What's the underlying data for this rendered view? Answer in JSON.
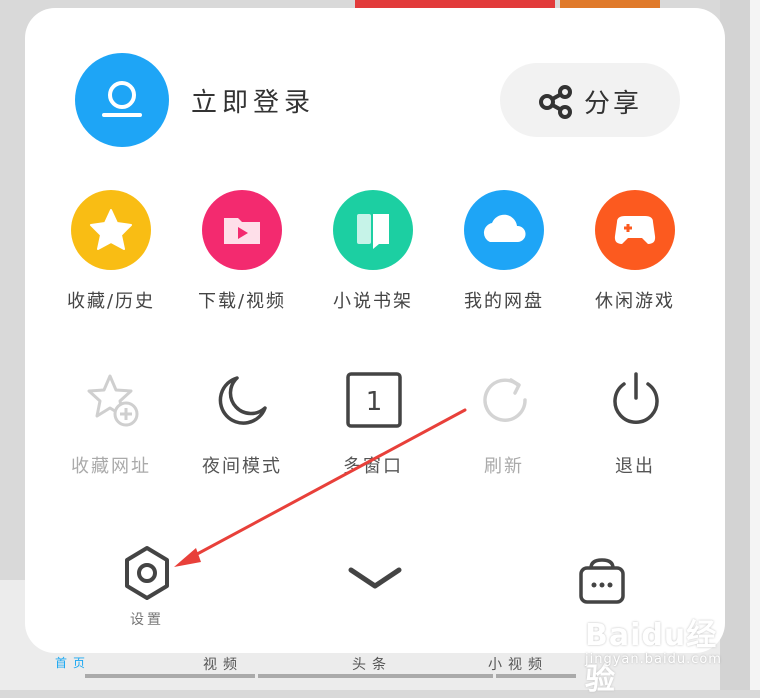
{
  "header": {
    "login_label": "立即登录",
    "share_label": "分享"
  },
  "apps": [
    {
      "label": "收藏/历史",
      "color": "#f9bd14",
      "icon": "star-icon"
    },
    {
      "label": "下载/视频",
      "color": "#f32a6f",
      "icon": "video-folder-icon"
    },
    {
      "label": "小说书架",
      "color": "#1ccfa2",
      "icon": "book-icon"
    },
    {
      "label": "我的网盘",
      "color": "#1ea5f6",
      "icon": "cloud-icon"
    },
    {
      "label": "休闲游戏",
      "color": "#fc5a1f",
      "icon": "gamepad-icon"
    }
  ],
  "tools": [
    {
      "label": "收藏网址",
      "icon": "star-add-icon",
      "enabled": false
    },
    {
      "label": "夜间模式",
      "icon": "moon-icon",
      "enabled": true
    },
    {
      "label": "多窗口",
      "icon": "window-icon",
      "window_count": "1",
      "enabled": true
    },
    {
      "label": "刷新",
      "icon": "refresh-icon",
      "enabled": false
    },
    {
      "label": "退出",
      "icon": "power-icon",
      "enabled": true
    }
  ],
  "footer": {
    "settings_label": "设置"
  },
  "bottom_nav": [
    {
      "label": "首页"
    },
    {
      "label": "视频"
    },
    {
      "label": "头条"
    },
    {
      "label": "小视频"
    }
  ],
  "watermark": {
    "logo": "Baidu经验",
    "url": "jingyan.baidu.com"
  }
}
